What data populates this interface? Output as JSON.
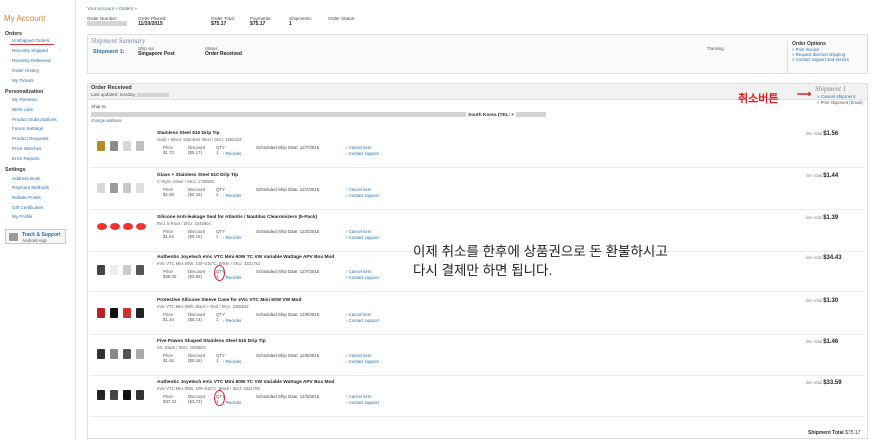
{
  "sidebar": {
    "title": "My Account",
    "orders_heading": "Orders",
    "orders": [
      "Unshipped Orders",
      "Recently Shipped",
      "Recently Delivered",
      "Order History",
      "My Tickets"
    ],
    "personalization_heading": "Personalization",
    "personalization": [
      "My Reviews",
      "Wish Lists",
      "Product Subscriptions",
      "Forum Settings",
      "Product Requests",
      "Price Watches",
      "Error Reports"
    ],
    "settings_heading": "Settings",
    "settings": [
      "Address Book",
      "Payment Methods",
      "Rebate Points",
      "Gift Certificates",
      "My Profile"
    ],
    "app_line1": "Track & Support",
    "app_line2": "Android App"
  },
  "breadcrumb": "Your Account » Orders »",
  "header": {
    "order_number_label": "Order Number:",
    "order_placed_label": "Order Placed:",
    "order_placed": "11/20/2015",
    "order_total_label": "Order Total:",
    "order_total": "$75.17",
    "payments_label": "Payments:",
    "payments": "$75.17",
    "shipments_label": "Shipments:",
    "shipments": "1",
    "order_status_label": "Order Status:"
  },
  "summary": {
    "title": "Shipment Summary",
    "shipment_label": "Shipment 1:",
    "ship_via_label": "Ship via",
    "ship_via": "Singapore Post",
    "status_label": "Status",
    "status": "Order Received",
    "tracking_label": "Tracking",
    "options_title": "Order Options",
    "options": [
      "» Print Invoice",
      "» Request discreet shipping",
      "» Contact support and service"
    ]
  },
  "order": {
    "title": "Order Received",
    "updated": "Last updated: Sunday,",
    "shipment_title": "Shipment 1",
    "cancel_shipment": "» Cancel shipment",
    "print_shipment": "» Print shipment (Email)",
    "ship_to_label": "Ship to:",
    "country": "South Korea (TEL: +",
    "change_address": "change address"
  },
  "labels": {
    "price": "Price",
    "discount": "Discount",
    "qty": "QTY",
    "reorder": "Reorder",
    "ssd": "Scheduled Ship Date:",
    "cancel_item": "› Cancel item",
    "contact_support": "› Contact support",
    "line_total": "line total"
  },
  "items": [
    {
      "name": "Stainless Steel 510 Drip Tip",
      "sub": "Gold + Silver, Stainless Steel / SKU: 1666102",
      "price": "$1.73",
      "discount": "($0.17)",
      "qty": "1",
      "date": "12/7/2015",
      "total": "$1.56"
    },
    {
      "name": "Glass + Stainless Steel 510 Drip Tip",
      "sub": "C-Style, Silver / SKU: 1760901",
      "price": "$1.60",
      "discount": "($0.16)",
      "qty": "1",
      "date": "12/7/2015",
      "total": "$1.44"
    },
    {
      "name": "Silicone Anti-leakage Seal for Atlantis / Nautilus Clearomizers (5-Pack)",
      "sub": "Red, 5-Pack / SKU: 2246804",
      "price": "$1.54",
      "discount": "($0.15)",
      "qty": "1",
      "date": "12/2/2015",
      "total": "$1.39"
    },
    {
      "name": "Authentic Joyetech eVic VTC Mini 60W TC VW Variable Wattage APV Box Mod",
      "sub": "eVic VTC Mini 60W, 100~315°C, White / SKU: 3331751",
      "price": "$38.25",
      "discount": "($3.82)",
      "qty": "1",
      "date": "12/7/2015",
      "total": "$34.43"
    },
    {
      "name": "Protective Silicone Sleeve Case for eVic VTC Mini 60W VW Mod",
      "sub": "eVic VTC Mini 60W, Black + Red / SKU: 3406832",
      "price": "$1.44",
      "discount": "($0.14)",
      "qty": "1",
      "date": "12/9/2015",
      "total": "$1.30"
    },
    {
      "name": "Five Pawns Shaped Stainless Steel 510 Drip Tip",
      "sub": "SS, Black / SKU: 2208822",
      "price": "$1.62",
      "discount": "($0.16)",
      "qty": "1",
      "date": "12/9/2015",
      "total": "$1.46"
    },
    {
      "name": "Authentic Joyetech eVic VTC Mini 60W TC VW Variable Wattage APV Box Mod",
      "sub": "eVic VTC Mini 60W, 100~315°C, Black / SKU: 3331700",
      "price": "$37.32",
      "discount": "($3.73)",
      "qty": "1",
      "date": "12/3/2015",
      "total": "$33.59"
    }
  ],
  "shipment_total_label": "Shipment Total",
  "shipment_total": "$75.17",
  "annotations": {
    "cancel_button": "취소버튼",
    "arrow": "⟶",
    "note_line1": "이제 취소를 한후에 상품권으로 돈 환불하시고",
    "note_line2": "다시 결제만 하면 됩니다."
  }
}
